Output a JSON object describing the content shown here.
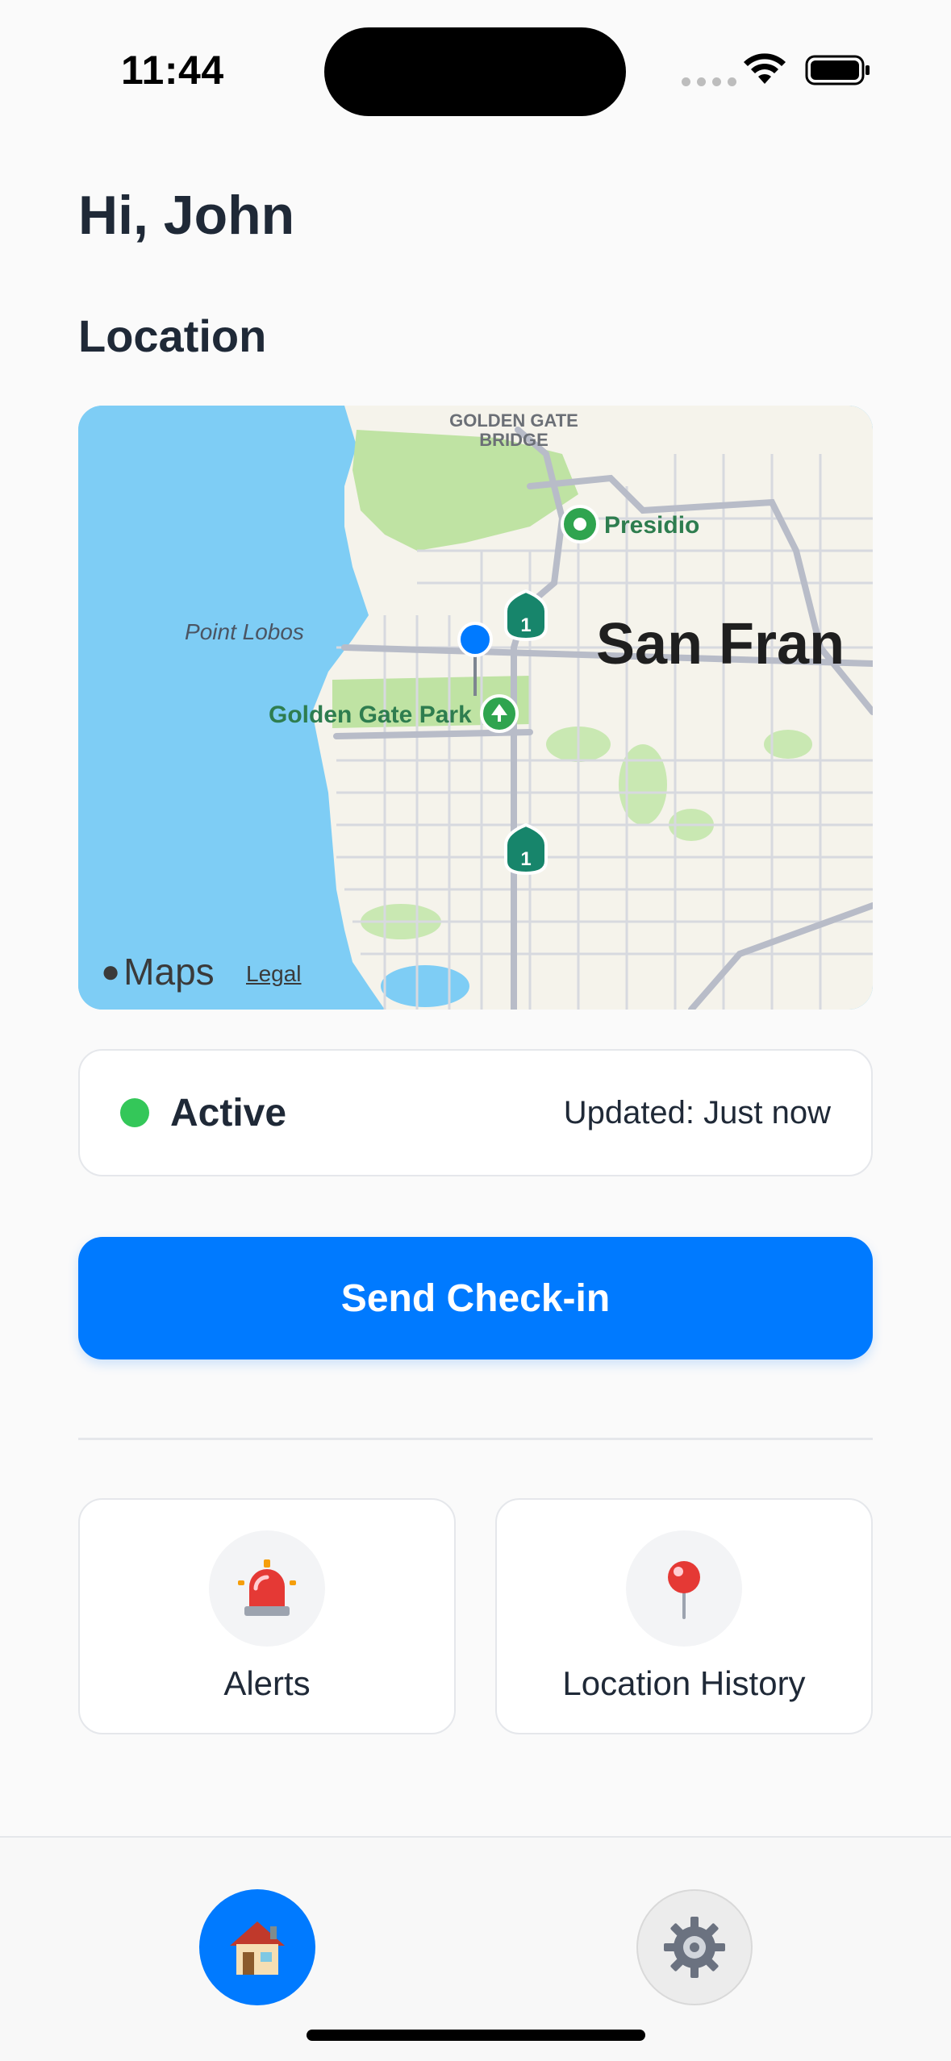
{
  "status_bar": {
    "time": "11:44"
  },
  "header": {
    "greeting": "Hi, John",
    "section_title": "Location"
  },
  "map": {
    "labels": {
      "bridge_line1": "GOLDEN GATE",
      "bridge_line2": "BRIDGE",
      "presidio": "Presidio",
      "point_lobos": "Point Lobos",
      "city": "San Fran",
      "park": "Golden Gate Park",
      "route_1": "1"
    },
    "attribution": "Maps",
    "legal": "Legal",
    "colors": {
      "water": "#7ECDF5",
      "land": "#F5F3EB",
      "park": "#BFE3A3",
      "road": "#B8BCC8",
      "pin": "#007AFF"
    }
  },
  "status": {
    "state": "Active",
    "updated": "Updated: Just now",
    "color": "#34C759"
  },
  "actions": {
    "checkin_label": "Send Check-in",
    "tiles": [
      {
        "label": "Alerts",
        "icon": "siren-icon",
        "glyph": "🚨"
      },
      {
        "label": "Location History",
        "icon": "pushpin-icon",
        "glyph": "📍"
      }
    ]
  },
  "tab_bar": {
    "items": [
      {
        "name": "home",
        "icon": "house-icon",
        "glyph": "🏠",
        "active": true
      },
      {
        "name": "settings",
        "icon": "gear-icon",
        "glyph": "⚙️",
        "active": false
      }
    ]
  },
  "theme": {
    "accent": "#007AFF",
    "text": "#1F2937",
    "border": "#E5E7EB"
  }
}
